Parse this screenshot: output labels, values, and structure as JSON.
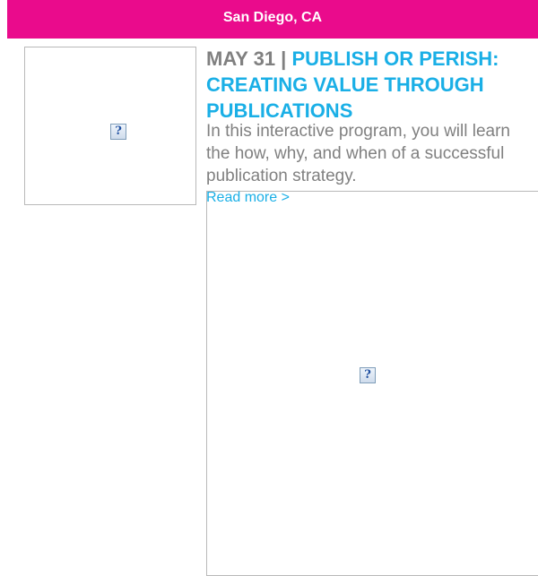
{
  "banner": {
    "location": "San Diego, CA"
  },
  "event": {
    "date_prefix": "MAY 31 | ",
    "title": "PUBLISH OR PERISH: CREATING VALUE THROUGH PUBLICATIONS",
    "description": "In this interactive program, you will learn the how, why, and when of a successful publication strategy.",
    "read_more": "Read more >"
  },
  "icons": {
    "thumbnail": "broken-image-icon",
    "banner_image": "broken-image-icon"
  },
  "colors": {
    "banner_bg": "#ea0b8c",
    "link": "#1aafe6",
    "text": "#808080"
  }
}
